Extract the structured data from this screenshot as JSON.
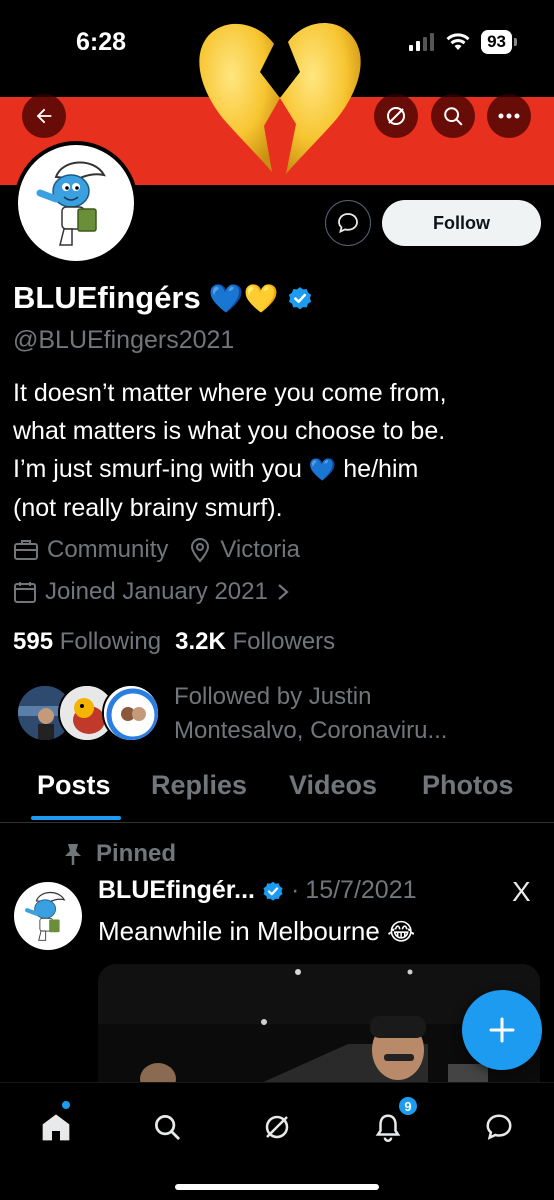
{
  "status_bar": {
    "time": "6:28",
    "battery": "93"
  },
  "banner": {
    "color": "#e8301e"
  },
  "profile": {
    "display_name": "BLUEfingérs",
    "name_emojis": "💙💛",
    "handle": "@BLUEfingers2021",
    "bio_line1": "It doesn’t matter where you come from,",
    "bio_line2": "what matters is what you choose to be.",
    "bio_line3_a": "I’m just smurf-ing with you",
    "bio_line3_emoji": "💙",
    "bio_line3_b": "he/him",
    "bio_line4": "(not really brainy smurf).",
    "category": "Community",
    "location": "Victoria",
    "joined": "Joined January 2021",
    "following_count": "595",
    "following_label": "Following",
    "followers_count": "3.2K",
    "followers_label": "Followers",
    "followed_by_line1": "Followed by Justin",
    "followed_by_line2": "Montesalvo, Coronaviru..."
  },
  "actions": {
    "follow_label": "Follow"
  },
  "tabs": [
    {
      "label": "Posts",
      "active": true
    },
    {
      "label": "Replies",
      "active": false
    },
    {
      "label": "Videos",
      "active": false
    },
    {
      "label": "Photos",
      "active": false
    }
  ],
  "post": {
    "pinned_label": "Pinned",
    "author": "BLUEfingér...",
    "date": "15/7/2021",
    "separator": "·",
    "text": "Meanwhile in Melbourne",
    "emoji": "😂",
    "x_mark": "X"
  },
  "nav": {
    "notification_count": "9"
  },
  "colors": {
    "accent": "#1d9bf0",
    "background": "#000000",
    "muted": "#71767b"
  }
}
